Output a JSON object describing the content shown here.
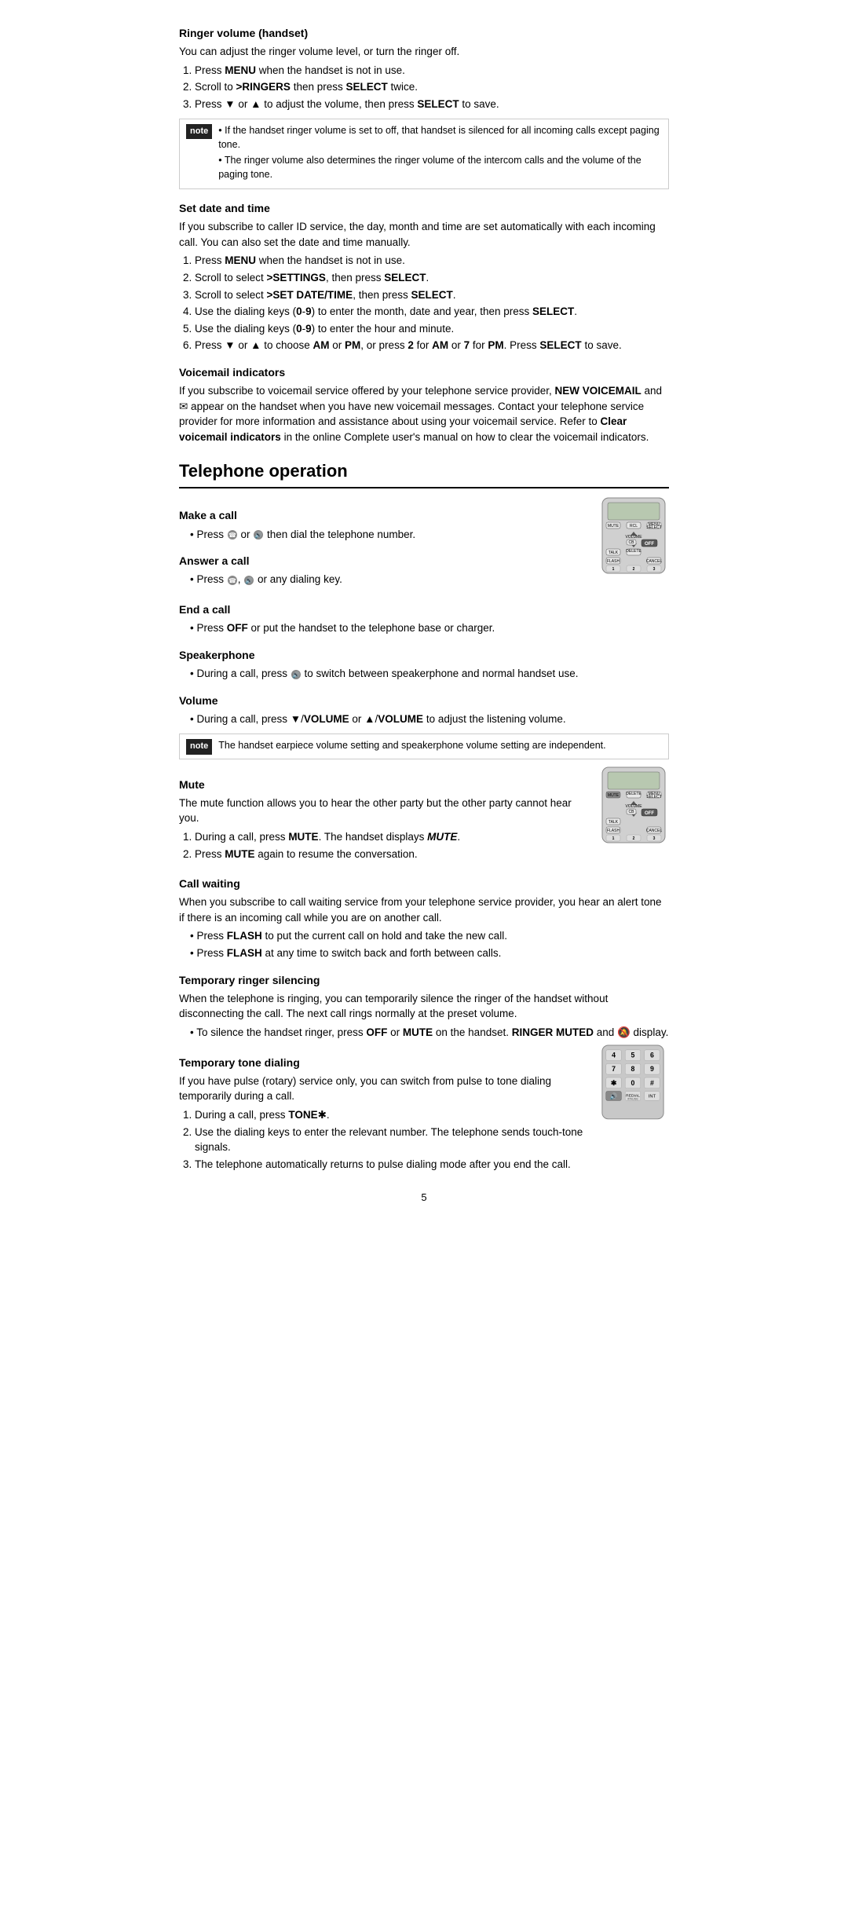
{
  "page": {
    "number": "5"
  },
  "sections": {
    "ringer_volume": {
      "title": "Ringer volume (handset)",
      "intro": "You can adjust the ringer volume level, or turn the ringer off.",
      "steps": [
        "Press <b>MENU</b> when the handset is not in use.",
        "Scroll to <b>>RINGERS</b> then press <b>SELECT</b> twice.",
        "Press ▼ or ▲ to adjust the volume, then press <b>SELECT</b> to save."
      ],
      "notes": [
        "If the handset ringer volume is set to off, that handset is silenced for all incoming calls except paging tone.",
        "The ringer volume also determines the ringer volume of the intercom calls and the volume of the paging tone."
      ]
    },
    "set_date_time": {
      "title": "Set date and time",
      "intro": "If you subscribe to caller ID service, the day, month and time are set automatically with each incoming call. You can also set the date and time manually.",
      "steps": [
        "Press <b>MENU</b> when the handset is not in use.",
        "Scroll to select <b>>SETTINGS</b>, then press <b>SELECT</b>.",
        "Scroll to select <b>>SET DATE/TIME</b>, then press <b>SELECT</b>.",
        "Use the dialing keys (<b>0</b>-<b>9</b>) to enter the month, date and year, then press <b>SELECT</b>.",
        "Use the dialing keys (<b>0</b>-<b>9</b>) to enter the hour and minute.",
        "Press ▼ or ▲ to choose <b>AM</b> or <b>PM</b>, or press <b>2</b> for <b>AM</b> or <b>7</b> for <b>PM</b>. Press <b>SELECT</b> to save."
      ]
    },
    "voicemail": {
      "title": "Voicemail indicators",
      "text": "If you subscribe to voicemail service offered by your telephone service provider, <b>NEW VOICEMAIL</b> and ✉ appear on the handset when you have new voicemail messages. Contact your telephone service provider for more information and assistance about using your voicemail service. Refer to <b>Clear voicemail indicators</b> in the online Complete user's manual on how to clear the voicemail indicators."
    },
    "telephone_operation": {
      "title": "Telephone operation",
      "subsections": {
        "make_call": {
          "title": "Make a call",
          "bullets": [
            "Press 📞 or 🔊 then dial the telephone number."
          ]
        },
        "answer_call": {
          "title": "Answer a call",
          "bullets": [
            "Press 📞, 🔊 or any dialing key."
          ]
        },
        "end_call": {
          "title": "End a call",
          "bullets": [
            "Press <b>OFF</b> or put the handset to the telephone base or charger."
          ]
        },
        "speakerphone": {
          "title": "Speakerphone",
          "bullets": [
            "During a call, press 🔊 to switch between speakerphone and normal handset use."
          ]
        },
        "volume": {
          "title": "Volume",
          "bullets": [
            "During a call, press ▼/<b>VOLUME</b> or ▲/<b>VOLUME</b> to adjust the listening volume."
          ],
          "note": "The handset earpiece volume setting and speakerphone volume setting are independent."
        },
        "mute": {
          "title": "Mute",
          "intro": "The mute function allows you to hear the other party but the other party cannot hear you.",
          "steps": [
            "During a call, press <b>MUTE</b>. The handset displays <i><b>MUTE</b></i>.",
            "Press <b>MUTE</b> again to resume the conversation."
          ]
        },
        "call_waiting": {
          "title": "Call waiting",
          "intro": "When you subscribe to call waiting service from your telephone service provider, you hear an alert tone if there is an incoming call while you are on another call.",
          "bullets": [
            "Press <b>FLASH</b> to put the current call on hold and take the new call.",
            "Press <b>FLASH</b> at any time to switch back and forth between calls."
          ]
        },
        "temp_ringer": {
          "title": "Temporary ringer silencing",
          "intro": "When the telephone is ringing, you can temporarily silence the ringer of the handset without disconnecting the call. The next call rings normally at the preset volume.",
          "bullets": [
            "To silence the handset ringer, press <b>OFF</b> or <b>MUTE</b> on the handset. <b>RINGER MUTED</b> and 🔕 display."
          ]
        },
        "temp_tone": {
          "title": "Temporary tone dialing",
          "intro": "If you have pulse (rotary) service only, you can switch from pulse to tone dialing temporarily during a call.",
          "steps": [
            "During a call, press <b>TONE</b>✱.",
            "Use the dialing keys to enter the relevant number. The telephone sends touch-tone signals.",
            "The telephone automatically returns to pulse dialing mode after you end the call."
          ]
        }
      }
    }
  },
  "labels": {
    "note": "note",
    "menu": "MENU",
    "delete": "DELETE",
    "select": "SELECT",
    "volume": "VOLUME",
    "off": "OFF",
    "flash": "FLASH",
    "cancel": "CANCEL",
    "mute": "MUTE",
    "talk": "TALK",
    "redial": "REDIAL",
    "int": "INT"
  }
}
